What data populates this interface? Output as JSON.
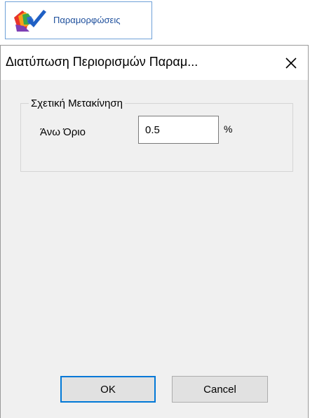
{
  "ribbon": {
    "label": "Παραμορφώσεις",
    "icon": "deformation-icon"
  },
  "dialog": {
    "title": "Διατύπωση  Περιορισμών Παραμ...",
    "close_icon": "close-icon",
    "group": {
      "legend": "Σχετική Μετακίνηση",
      "field_label": "Άνω Όριο",
      "field_value": "0.5",
      "unit": "%"
    },
    "buttons": {
      "ok": "OK",
      "cancel": "Cancel"
    }
  },
  "colors": {
    "accent": "#0078d7",
    "ribbon_text": "#1e4f9c",
    "dialog_background": "#f0f0f0"
  }
}
